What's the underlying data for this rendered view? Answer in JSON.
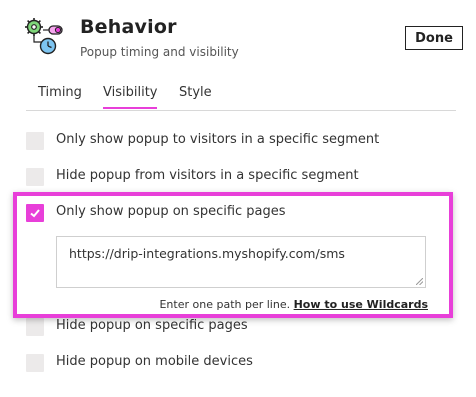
{
  "header": {
    "title": "Behavior",
    "subtitle": "Popup timing and visibility",
    "icon": "gear-clock-icon",
    "done_label": "Done"
  },
  "tabs": [
    {
      "label": "Timing",
      "active": false
    },
    {
      "label": "Visibility",
      "active": true
    },
    {
      "label": "Style",
      "active": false
    }
  ],
  "options": [
    {
      "label": "Only show popup to visitors in a specific segment",
      "checked": false
    },
    {
      "label": "Hide popup from visitors in a specific segment",
      "checked": false
    },
    {
      "label": "Only show popup on specific pages",
      "checked": true
    },
    {
      "label": "Hide popup on specific pages",
      "checked": false
    },
    {
      "label": "Hide popup on mobile devices",
      "checked": false
    }
  ],
  "pages_field": {
    "value": "https://drip-integrations.myshopify.com/sms"
  },
  "helper": {
    "text": "Enter one path per line.",
    "link": "How to use Wildcards"
  },
  "colors": {
    "accent": "#e83fd9",
    "highlight_border": "#e83fd9",
    "checkbox_unchecked": "#eceaea"
  }
}
